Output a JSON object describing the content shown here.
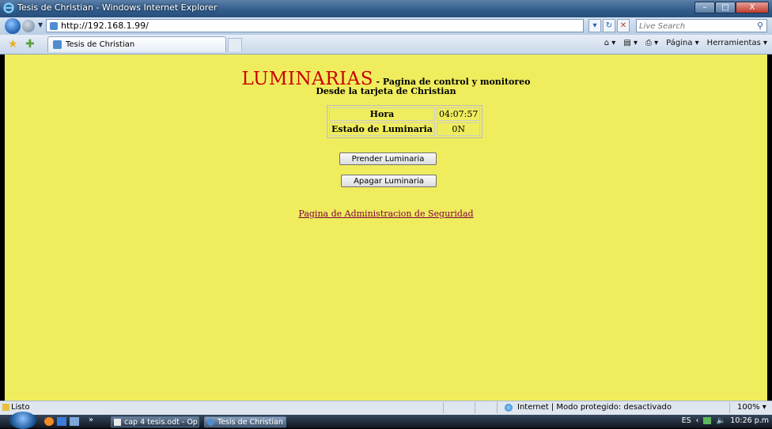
{
  "window": {
    "title": "Tesis de Christian - Windows Internet Explorer",
    "minimize": "–",
    "maximize": "□",
    "close": "X"
  },
  "nav": {
    "url": "http://192.168.1.99/",
    "search_placeholder": "Live Search",
    "refresh": "↻",
    "stop": "✕"
  },
  "tabs": {
    "active": "Tesis de Christian"
  },
  "command_bar": {
    "home": "⌂ ▾",
    "feeds": "▤ ▾",
    "print": "⎙ ▾",
    "page": "Página ▾",
    "tools": "Herramientas ▾"
  },
  "page": {
    "title_big": "LUMINARIAS",
    "title_small": "- Pagina de control y monitoreo",
    "subtitle": "Desde la tarjeta de Christian",
    "table": [
      {
        "label": "Hora",
        "value": "04:07:57"
      },
      {
        "label": "Estado de Luminaria",
        "value": "0N"
      }
    ],
    "btn_on": "Prender Luminaria",
    "btn_off": "Apagar Luminaria",
    "admin_link": "Pagina de Administracion de Seguridad"
  },
  "status": {
    "text": "Listo",
    "zone": "Internet | Modo protegido: desactivado",
    "zoom": "100%  ▾"
  },
  "taskbar": {
    "task1": "cap 4 tesis.odt - Op...",
    "task2": "Tesis de Christian - ...",
    "lang": "ES",
    "clock": "10:26 p.m",
    "more": "»"
  },
  "colors": {
    "page_bg": "#efed5e",
    "title_red": "#cc0000",
    "link": "#800040"
  }
}
